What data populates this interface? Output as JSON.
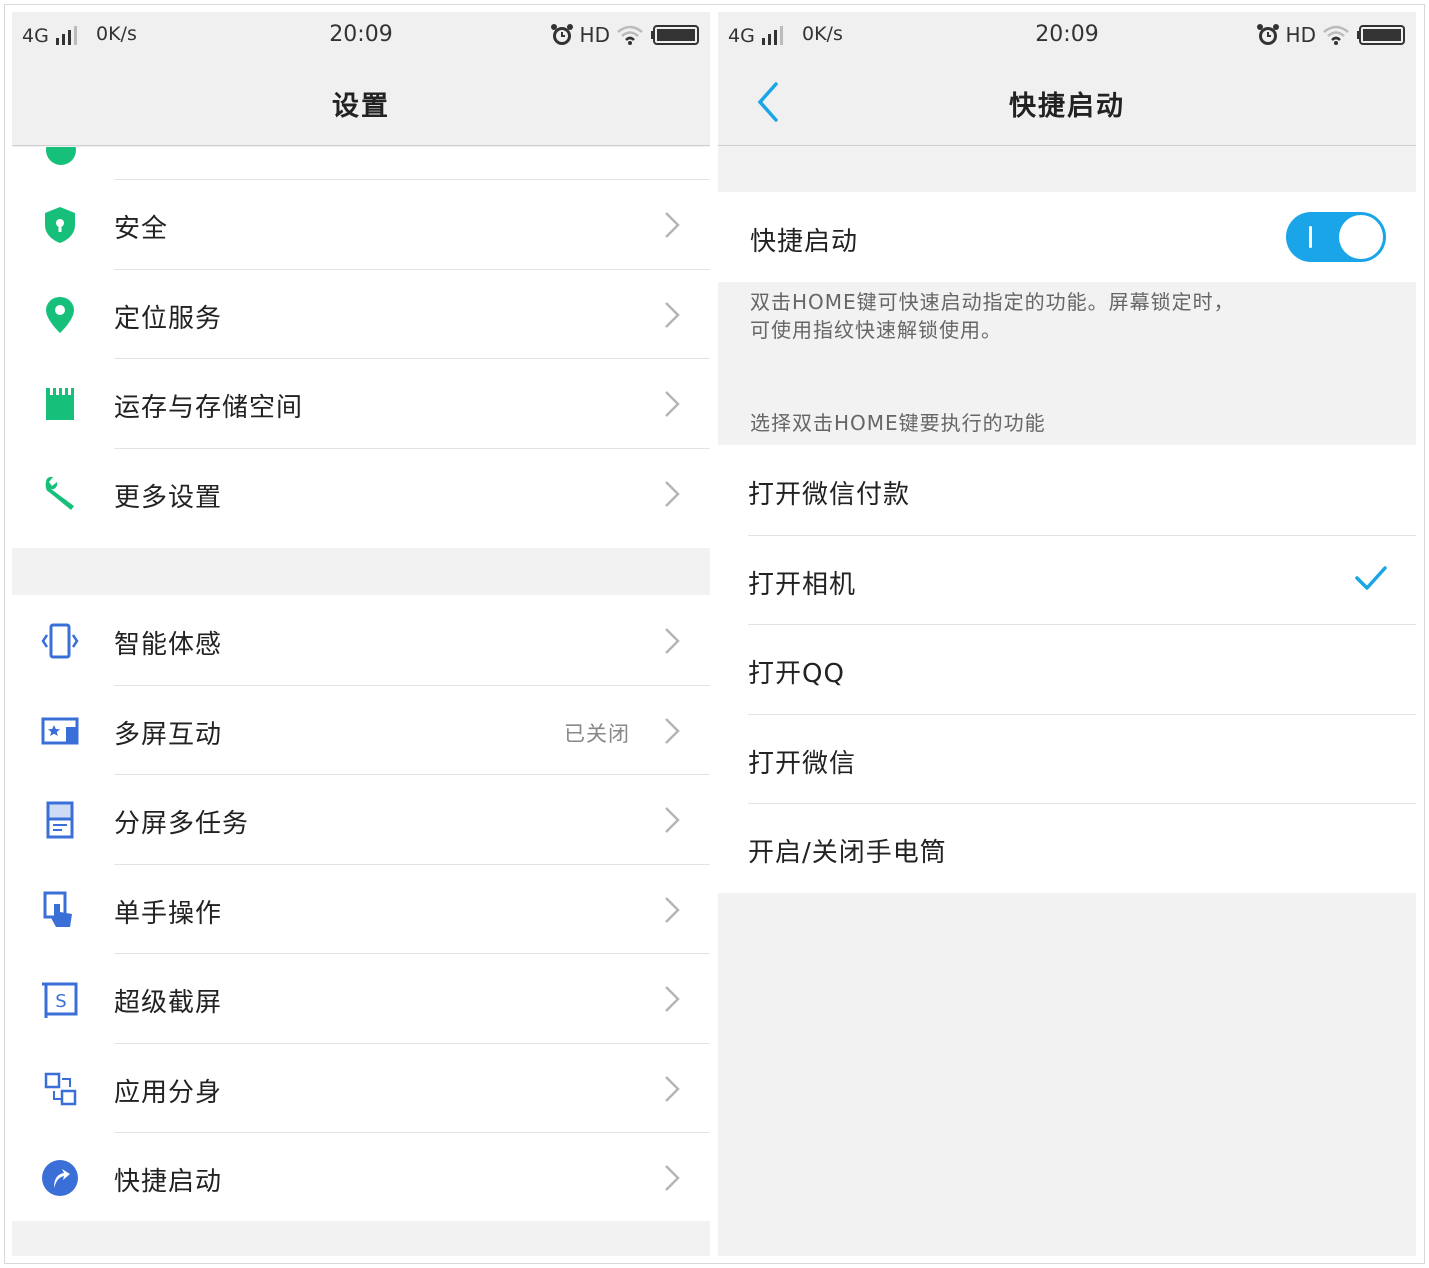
{
  "status_bar": {
    "network": "4G",
    "speed": "0K/s",
    "time": "20:09",
    "hd": "HD"
  },
  "left_screen": {
    "title": "设置",
    "group1": [
      {
        "label": "安全",
        "icon": "shield-icon"
      },
      {
        "label": "定位服务",
        "icon": "location-pin-icon"
      },
      {
        "label": "运存与存储空间",
        "icon": "sd-card-icon"
      },
      {
        "label": "更多设置",
        "icon": "wrench-icon"
      }
    ],
    "group2": [
      {
        "label": "智能体感",
        "icon": "motion-sense-icon",
        "value": ""
      },
      {
        "label": "多屏互动",
        "icon": "screen-cast-icon",
        "value": "已关闭"
      },
      {
        "label": "分屏多任务",
        "icon": "split-screen-icon",
        "value": ""
      },
      {
        "label": "单手操作",
        "icon": "one-hand-icon",
        "value": ""
      },
      {
        "label": "超级截屏",
        "icon": "screenshot-icon",
        "value": ""
      },
      {
        "label": "应用分身",
        "icon": "app-clone-icon",
        "value": ""
      },
      {
        "label": "快捷启动",
        "icon": "quick-launch-icon",
        "value": ""
      }
    ]
  },
  "right_screen": {
    "title": "快捷启动",
    "toggle_label": "快捷启动",
    "toggle_on": true,
    "description": "双击HOME键可快速启动指定的功能。屏幕锁定时，可使用指纹快速解锁使用。",
    "description_line1": "双击HOME键可快速启动指定的功能。屏幕锁定时，",
    "description_line2": "可使用指纹快速解锁使用。",
    "section_header": "选择双击HOME键要执行的功能",
    "options": [
      {
        "label": "打开微信付款",
        "selected": false
      },
      {
        "label": "打开相机",
        "selected": true
      },
      {
        "label": "打开QQ",
        "selected": false
      },
      {
        "label": "打开微信",
        "selected": false
      },
      {
        "label": "开启/关闭手电筒",
        "selected": false
      }
    ]
  },
  "colors": {
    "accent": "#1aa5e8",
    "green_icon": "#17c07a",
    "blue_icon": "#3b6fd8",
    "chevron": "#b5b5b5"
  }
}
